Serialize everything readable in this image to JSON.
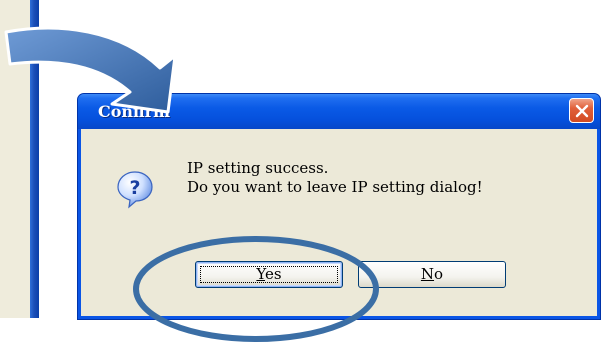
{
  "dialog": {
    "title": "Confirm",
    "message_line1": "IP setting success.",
    "message_line2": "Do you want to leave IP setting dialog!",
    "icon": "question-icon",
    "buttons": {
      "yes": {
        "label_first": "Y",
        "label_rest": "es"
      },
      "no": {
        "label_first": "N",
        "label_rest": "o"
      }
    },
    "close_icon": "close-icon"
  },
  "annotations": {
    "arrow_icon": "curved-arrow-icon",
    "highlight": "ellipse-highlight-yes-button"
  },
  "colors": {
    "titlebar": "#0a55e6",
    "close_button": "#e1603a",
    "dialog_face": "#ece9d8",
    "annotation": "#3b6ea5"
  }
}
